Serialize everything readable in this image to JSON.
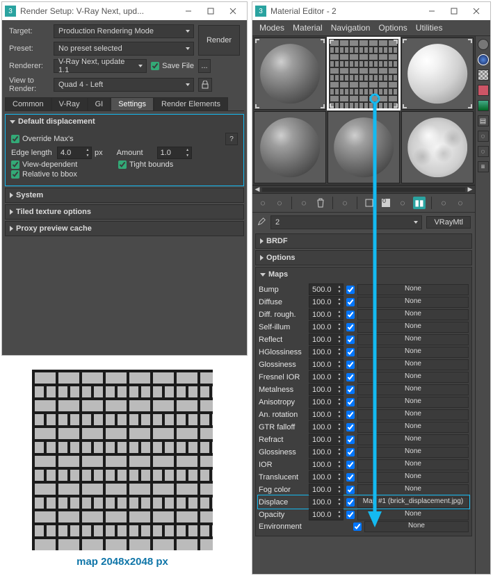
{
  "render_setup": {
    "title": "Render Setup: V-Ray Next, upd...",
    "labels": {
      "target": "Target:",
      "preset": "Preset:",
      "renderer": "Renderer:",
      "view": "View to Render:"
    },
    "target_value": "Production Rendering Mode",
    "preset_value": "No preset selected",
    "renderer_value": "V-Ray Next, update 1.1",
    "save_file_label": "Save File",
    "ellipsis": "...",
    "render_btn": "Render",
    "view_value": "Quad 4 - Left",
    "tabs": [
      "Common",
      "V-Ray",
      "GI",
      "Settings",
      "Render Elements"
    ],
    "active_tab_index": 3,
    "displace": {
      "title": "Default displacement",
      "override": "Override Max's",
      "edge_label": "Edge length",
      "edge_value": "4.0",
      "edge_unit": "px",
      "amount_label": "Amount",
      "amount_value": "1.0",
      "view_dep": "View-dependent",
      "tight": "Tight bounds",
      "relative": "Relative to bbox"
    },
    "other_rollups": [
      "System",
      "Tiled texture options",
      "Proxy preview cache"
    ]
  },
  "mat_editor": {
    "title": "Material Editor - 2",
    "menus": [
      "Modes",
      "Material",
      "Navigation",
      "Options",
      "Utilities"
    ],
    "mat_name": "2",
    "mat_type": "VRayMtl",
    "rollups_collapsed": [
      "BRDF",
      "Options"
    ],
    "maps_title": "Maps",
    "maps": [
      {
        "name": "Bump",
        "amt": "500.0",
        "on": true,
        "map": "None"
      },
      {
        "name": "Diffuse",
        "amt": "100.0",
        "on": true,
        "map": "None"
      },
      {
        "name": "Diff. rough.",
        "amt": "100.0",
        "on": true,
        "map": "None"
      },
      {
        "name": "Self-illum",
        "amt": "100.0",
        "on": true,
        "map": "None"
      },
      {
        "name": "Reflect",
        "amt": "100.0",
        "on": true,
        "map": "None"
      },
      {
        "name": "HGlossiness",
        "amt": "100.0",
        "on": true,
        "map": "None"
      },
      {
        "name": "Glossiness",
        "amt": "100.0",
        "on": true,
        "map": "None"
      },
      {
        "name": "Fresnel IOR",
        "amt": "100.0",
        "on": true,
        "map": "None"
      },
      {
        "name": "Metalness",
        "amt": "100.0",
        "on": true,
        "map": "None"
      },
      {
        "name": "Anisotropy",
        "amt": "100.0",
        "on": true,
        "map": "None"
      },
      {
        "name": "An. rotation",
        "amt": "100.0",
        "on": true,
        "map": "None"
      },
      {
        "name": "GTR falloff",
        "amt": "100.0",
        "on": true,
        "map": "None"
      },
      {
        "name": "Refract",
        "amt": "100.0",
        "on": true,
        "map": "None"
      },
      {
        "name": "Glossiness",
        "amt": "100.0",
        "on": true,
        "map": "None"
      },
      {
        "name": "IOR",
        "amt": "100.0",
        "on": true,
        "map": "None"
      },
      {
        "name": "Translucent",
        "amt": "100.0",
        "on": true,
        "map": "None"
      },
      {
        "name": "Fog color",
        "amt": "100.0",
        "on": true,
        "map": "None"
      },
      {
        "name": "Displace",
        "amt": "100.0",
        "on": true,
        "map": "Map #1 (brick_displacement.jpg)"
      },
      {
        "name": "Opacity",
        "amt": "100.0",
        "on": true,
        "map": "None"
      }
    ],
    "env_label": "Environment",
    "env_on": true,
    "env_map": "None",
    "highlight_map_index": 17
  },
  "brick_caption": "map 2048x2048 px"
}
